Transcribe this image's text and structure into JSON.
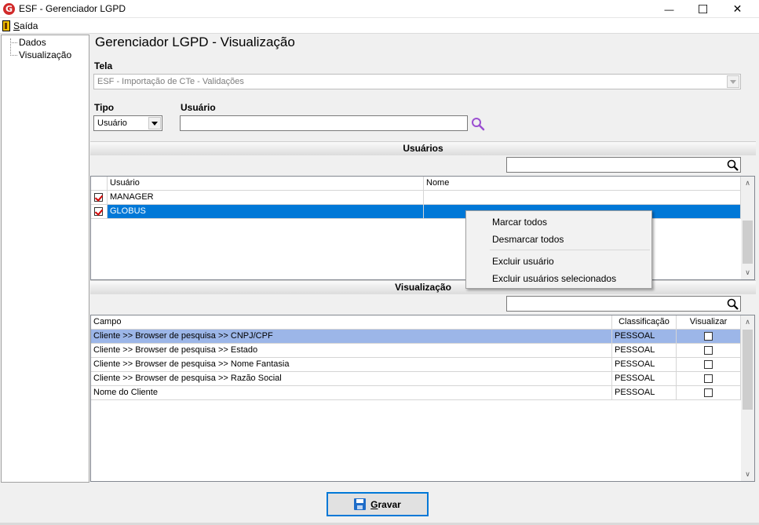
{
  "window": {
    "title": "ESF - Gerenciador LGPD",
    "logo_letter": "G",
    "minimize_glyph": "—",
    "maximize_glyph": "☐",
    "close_glyph": "✕"
  },
  "menu": {
    "exit_label": "Saída"
  },
  "tree": {
    "items": [
      "Dados",
      "Visualização"
    ]
  },
  "page_title": "Gerenciador LGPD - Visualização",
  "form": {
    "tela_label": "Tela",
    "tela_value": "ESF - Importação de CTe - Validações",
    "tipo_label": "Tipo",
    "tipo_value": "Usuário",
    "usuario_label": "Usuário",
    "usuario_value": ""
  },
  "users_section": {
    "title": "Usuários",
    "filter_value": "",
    "columns": [
      "Usuário",
      "Nome"
    ],
    "rows": [
      {
        "usuario": "MANAGER",
        "nome": "",
        "checked": true,
        "selected": false
      },
      {
        "usuario": "GLOBUS",
        "nome": "",
        "checked": true,
        "selected": true
      }
    ]
  },
  "context_menu": {
    "items": [
      "Marcar todos",
      "Desmarcar todos",
      "Excluir usuário",
      "Excluir usuários selecionados"
    ]
  },
  "view_section": {
    "title": "Visualização",
    "filter_value": "",
    "columns": [
      "Campo",
      "Classificação",
      "Visualizar"
    ],
    "rows": [
      {
        "campo": "Cliente >> Browser de pesquisa >> CNPJ/CPF",
        "classificacao": "PESSOAL",
        "visualizar": false
      },
      {
        "campo": "Cliente >> Browser de pesquisa >> Estado",
        "classificacao": "PESSOAL",
        "visualizar": false
      },
      {
        "campo": "Cliente >> Browser de pesquisa >> Nome Fantasia",
        "classificacao": "PESSOAL",
        "visualizar": false
      },
      {
        "campo": "Cliente >> Browser de pesquisa >> Razão Social",
        "classificacao": "PESSOAL",
        "visualizar": false
      },
      {
        "campo": "Nome do Cliente",
        "classificacao": "PESSOAL",
        "visualizar": false
      }
    ]
  },
  "save_button_label": "Gravar",
  "colors": {
    "selection": "#0078d7",
    "row_highlight": "#9cb6e8",
    "check_mark": "#d40000",
    "search_icon_accent": "#9b4fd1"
  },
  "icons": [
    "app-logo-icon",
    "exit-icon",
    "search-icon",
    "chevron-down-icon",
    "save-disk-icon"
  ]
}
